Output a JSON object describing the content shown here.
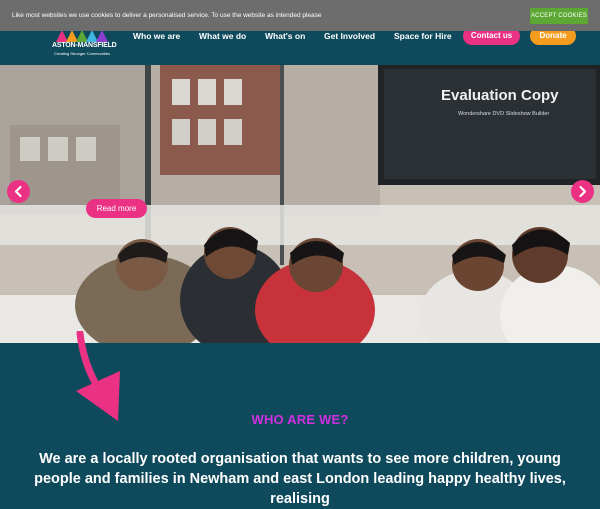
{
  "cookie": {
    "message": "Like most websites we use cookies to deliver a personalised service. To use the website as intended please",
    "accept_label": "ACCEPT COOKIES"
  },
  "logo": {
    "name": "ASTON-MANSFIELD",
    "tagline": "Creating Stronger Communities"
  },
  "nav": {
    "items": [
      "Who we are",
      "What we do",
      "What's on",
      "Get Involved",
      "Space for Hire"
    ],
    "contact_label": "Contact us",
    "donate_label": "Donate"
  },
  "hero": {
    "watermark_title": "Evaluation Copy",
    "watermark_subtitle": "Wondershare DVD Slideshow Builder",
    "read_more_label": "Read more"
  },
  "about": {
    "heading": "WHO ARE WE?",
    "text": "We are a locally rooted organisation that wants to see more children, young people and families in Newham and east London leading happy healthy lives, realising"
  },
  "colors": {
    "teal": "#0e4a5c",
    "pink": "#ea3184",
    "orange": "#f59c1f",
    "magenta": "#d12fe0",
    "cookie_green": "#5da834"
  }
}
